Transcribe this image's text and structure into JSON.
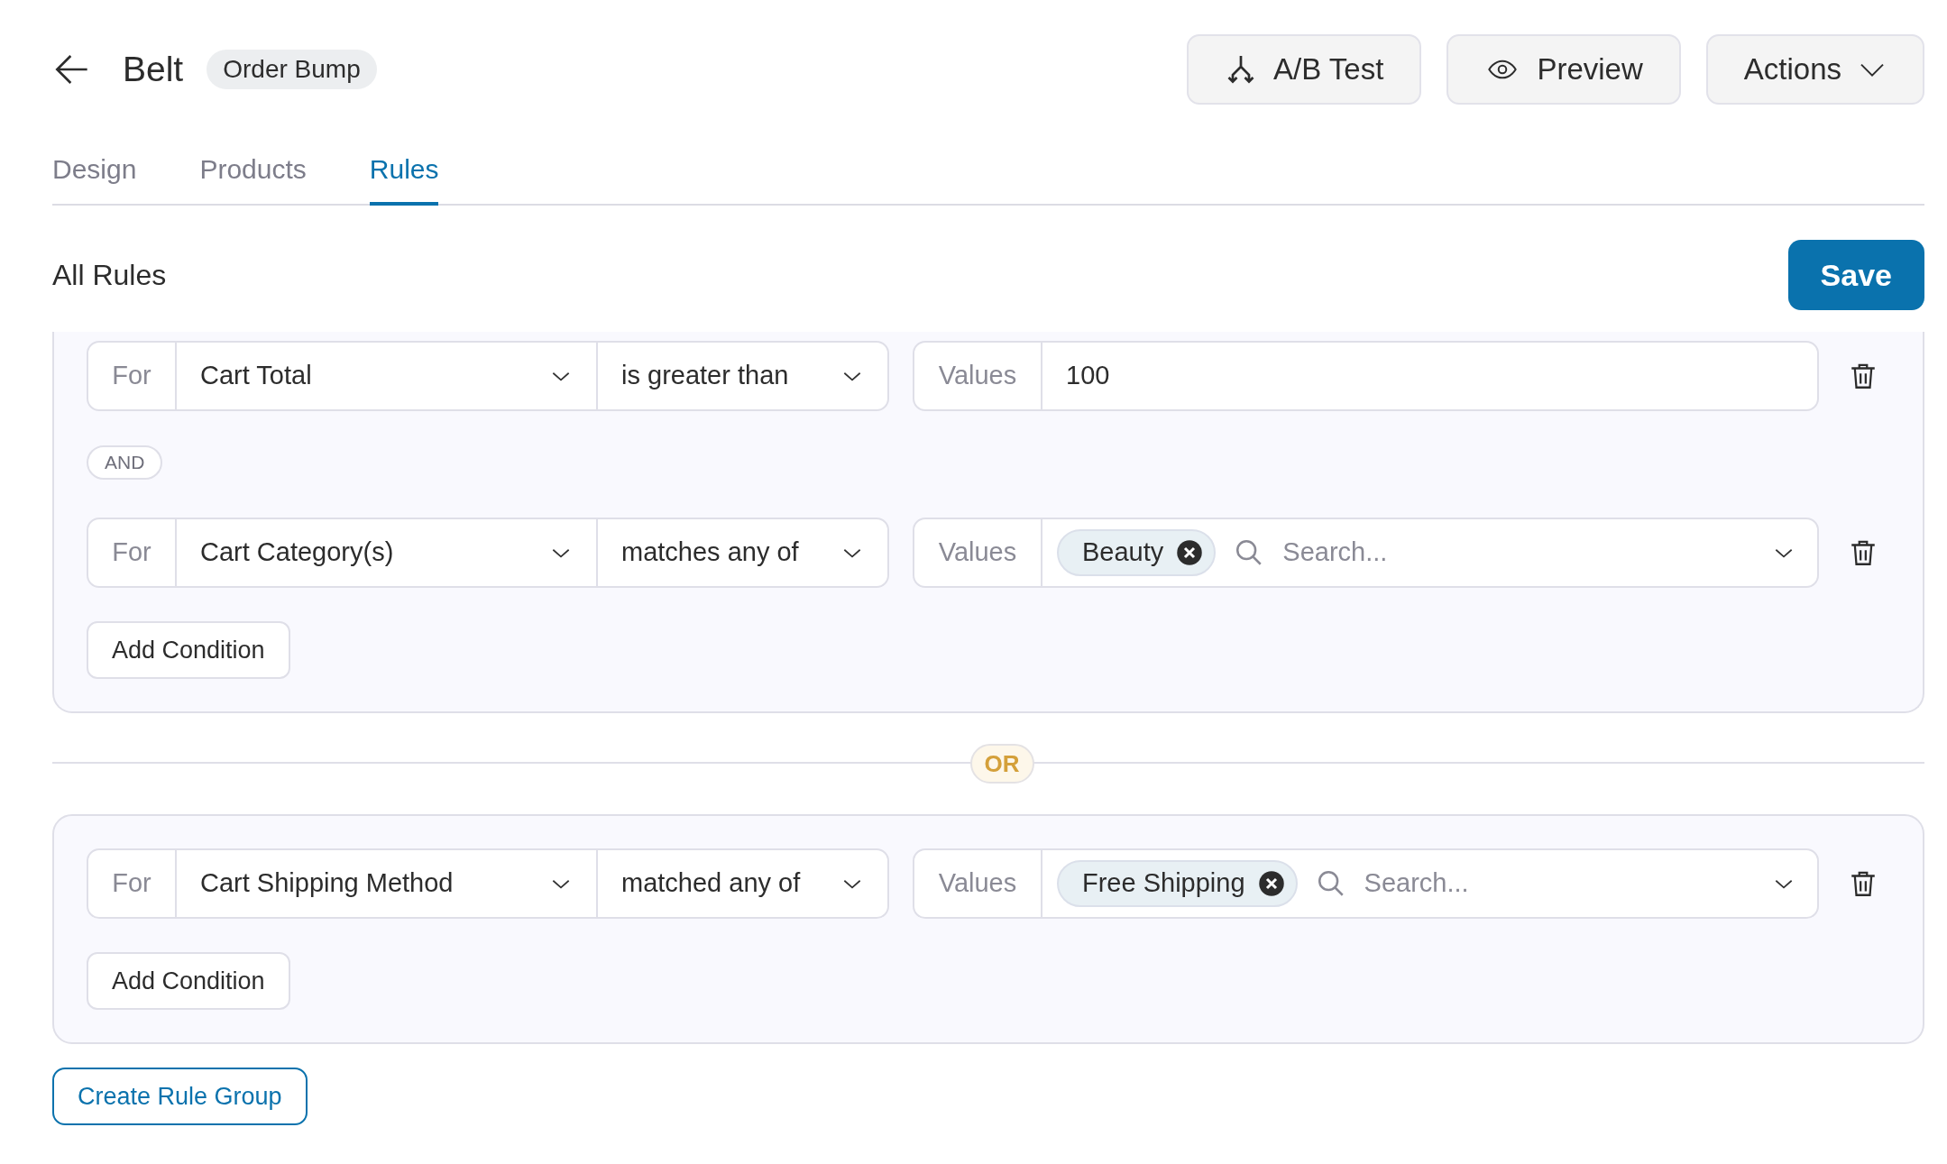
{
  "header": {
    "title": "Belt",
    "badge": "Order Bump",
    "buttons": [
      {
        "kind": "abtest",
        "label": "A/B Test"
      },
      {
        "kind": "preview",
        "label": "Preview"
      },
      {
        "kind": "actions",
        "label": "Actions"
      }
    ]
  },
  "tabs": [
    {
      "label": "Design",
      "selected": false
    },
    {
      "label": "Products",
      "selected": false
    },
    {
      "label": "Rules",
      "selected": true
    }
  ],
  "section": {
    "title": "All Rules",
    "save": "Save"
  },
  "groups": [
    {
      "conditions": [
        {
          "for": "For",
          "field": "Cart Total",
          "operator": "is greater than",
          "values_label": "Values",
          "kind": "text",
          "value": "100"
        },
        {
          "for": "For",
          "field": "Cart Category(s)",
          "operator": "matches any of",
          "values_label": "Values",
          "kind": "tags",
          "tags": [
            "Beauty"
          ],
          "placeholder": "Search..."
        }
      ],
      "joiner": "AND",
      "add_condition": "Add Condition"
    },
    {
      "conditions": [
        {
          "for": "For",
          "field": "Cart Shipping Method",
          "operator": "matched any of",
          "values_label": "Values",
          "kind": "tags",
          "tags": [
            "Free Shipping"
          ],
          "placeholder": "Search..."
        }
      ],
      "add_condition": "Add Condition"
    }
  ],
  "group_separator": "OR",
  "create_group": "Create Rule Group"
}
